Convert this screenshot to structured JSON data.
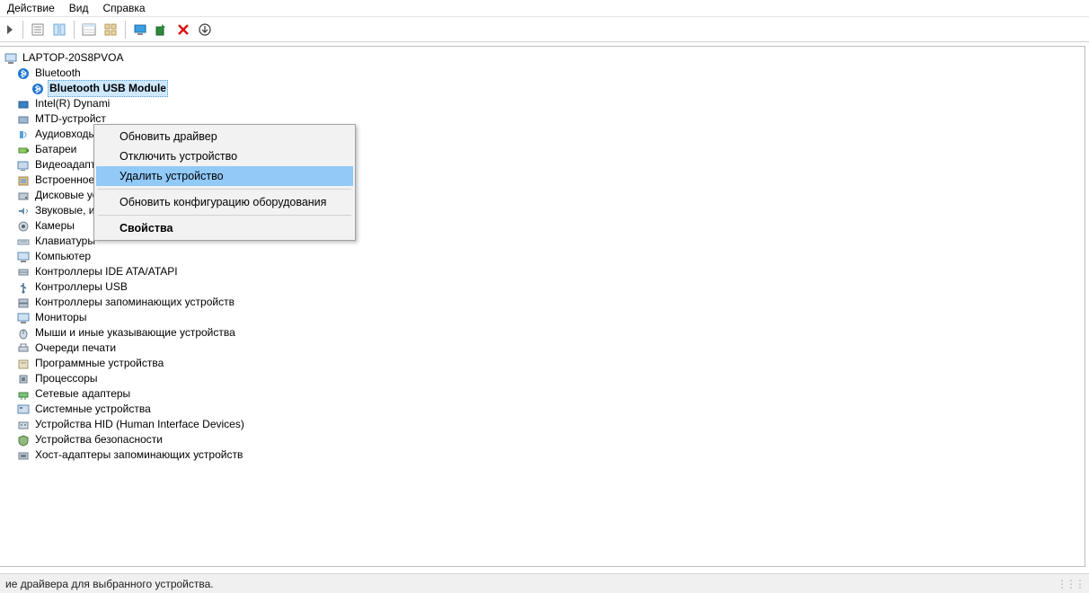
{
  "menu": {
    "action": "Действие",
    "view": "Вид",
    "help": "Справка"
  },
  "toolbar": {
    "back_label": "Назад",
    "props_label": "Свойства",
    "tree_layout_label": "Режим",
    "details_label": "Подробности",
    "monitor_label": "Монитор",
    "scan_label": "Обновить конфигурацию",
    "delete_label": "Удалить",
    "download_label": "Загрузить"
  },
  "tree": {
    "root": "LAPTOP-20S8PVOA",
    "bluetooth": {
      "label": "Bluetooth",
      "child": "Bluetooth USB Module"
    },
    "items": [
      "Intel(R) Dynami",
      "MTD-устройст",
      "Аудиовходы и а",
      "Батареи",
      "Видеоадаптер",
      "Встроенное ПС",
      "Дисковые устро......",
      "Звуковые, игровые и видеоустройства",
      "Камеры",
      "Клавиатуры",
      "Компьютер",
      "Контроллеры IDE ATA/ATAPI",
      "Контроллеры USB",
      "Контроллеры запоминающих устройств",
      "Мониторы",
      "Мыши и иные указывающие устройства",
      "Очереди печати",
      "Программные устройства",
      "Процессоры",
      "Сетевые адаптеры",
      "Системные устройства",
      "Устройства HID (Human Interface Devices)",
      "Устройства безопасности",
      "Хост-адаптеры запоминающих устройств"
    ]
  },
  "context_menu": {
    "update": "Обновить драйвер",
    "disable": "Отключить устройство",
    "delete": "Удалить устройство",
    "scan": "Обновить конфигурацию оборудования",
    "props": "Свойства"
  },
  "status": "ие драйвера для выбранного устройства."
}
